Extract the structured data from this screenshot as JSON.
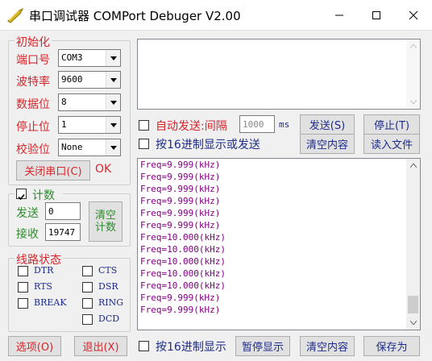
{
  "window": {
    "title": "串口调试器 COMPort Debuger V2.00"
  },
  "port_settings": {
    "legend": "初始化",
    "fields": [
      {
        "label": "端口号",
        "value": "COM3"
      },
      {
        "label": "波特率",
        "value": "9600"
      },
      {
        "label": "数据位",
        "value": "8"
      },
      {
        "label": "停止位",
        "value": "1"
      },
      {
        "label": "校验位",
        "value": "None"
      }
    ],
    "close_port_label": "关闭串口(C)",
    "status_text": "OK"
  },
  "counter": {
    "legend": "计数",
    "enabled": true,
    "send_label": "发送",
    "send_value": "0",
    "recv_label": "接收",
    "recv_value": "19747",
    "clear_label_1": "清空",
    "clear_label_2": "计数"
  },
  "line_status": {
    "legend": "线路状态",
    "signals": [
      "DTR",
      "CTS",
      "RTS",
      "DSR",
      "BREAK",
      "RING",
      "DCD"
    ]
  },
  "send_panel": {
    "auto_send_label": "自动发送:间隔",
    "interval_placeholder": "1000",
    "interval_unit": "ms",
    "send_button": "发送(S)",
    "stop_button": "停止(T)",
    "hex_send_label": "按16进制显示或发送",
    "clear_content_button": "清空内容",
    "read_file_button": "读入文件"
  },
  "receive": {
    "lines": [
      "Freq=9.999(kHz)",
      "Freq=9.999(kHz)",
      "Freq=9.999(kHz)",
      "Freq=9.999(kHz)",
      "Freq=9.999(kHz)",
      "Freq=9.999(kHz)",
      "Freq=10.000(kHz)",
      "Freq=10.000(kHz)",
      "Freq=10.000(kHz)",
      "Freq=10.000(kHz)",
      "Freq=10.000(kHz)",
      "Freq=9.999(kHz)",
      "Freq=9.999(kHz)"
    ]
  },
  "bottom_bar": {
    "options_button": "选项(O)",
    "exit_button": "退出(X)",
    "hex_display_label": "按16进制显示",
    "pause_button": "暂停显示",
    "clear_button": "清空内容",
    "save_button": "保存为"
  },
  "colors": {
    "label_red": "#d5262b",
    "text_purple": "#800080",
    "signal_blue": "#1d2b8c",
    "counter_green": "#2e8b2e"
  }
}
